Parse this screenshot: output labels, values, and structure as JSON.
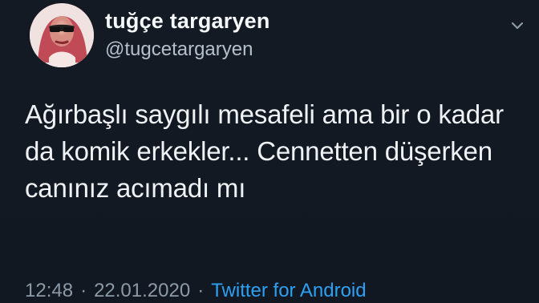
{
  "tweet": {
    "display_name": "tuğçe targaryen",
    "handle": "@tugcetargaryen",
    "text_lines": [
      "Ağırbaşlı saygılı mesafeli ama bir o kadar",
      "da komik erkekler... Cennetten düşerken",
      "canınız acımadı mı"
    ],
    "time": "12:48",
    "date": "22.01.2020",
    "separator": "·",
    "source": "Twitter for Android"
  },
  "icons": {
    "avatar": "profile-avatar",
    "menu": "chevron-down-icon"
  },
  "colors": {
    "background": "#15202b",
    "text": "#eef2f5",
    "secondary_text": "#8c99a6",
    "accent": "#2ea0f2"
  }
}
